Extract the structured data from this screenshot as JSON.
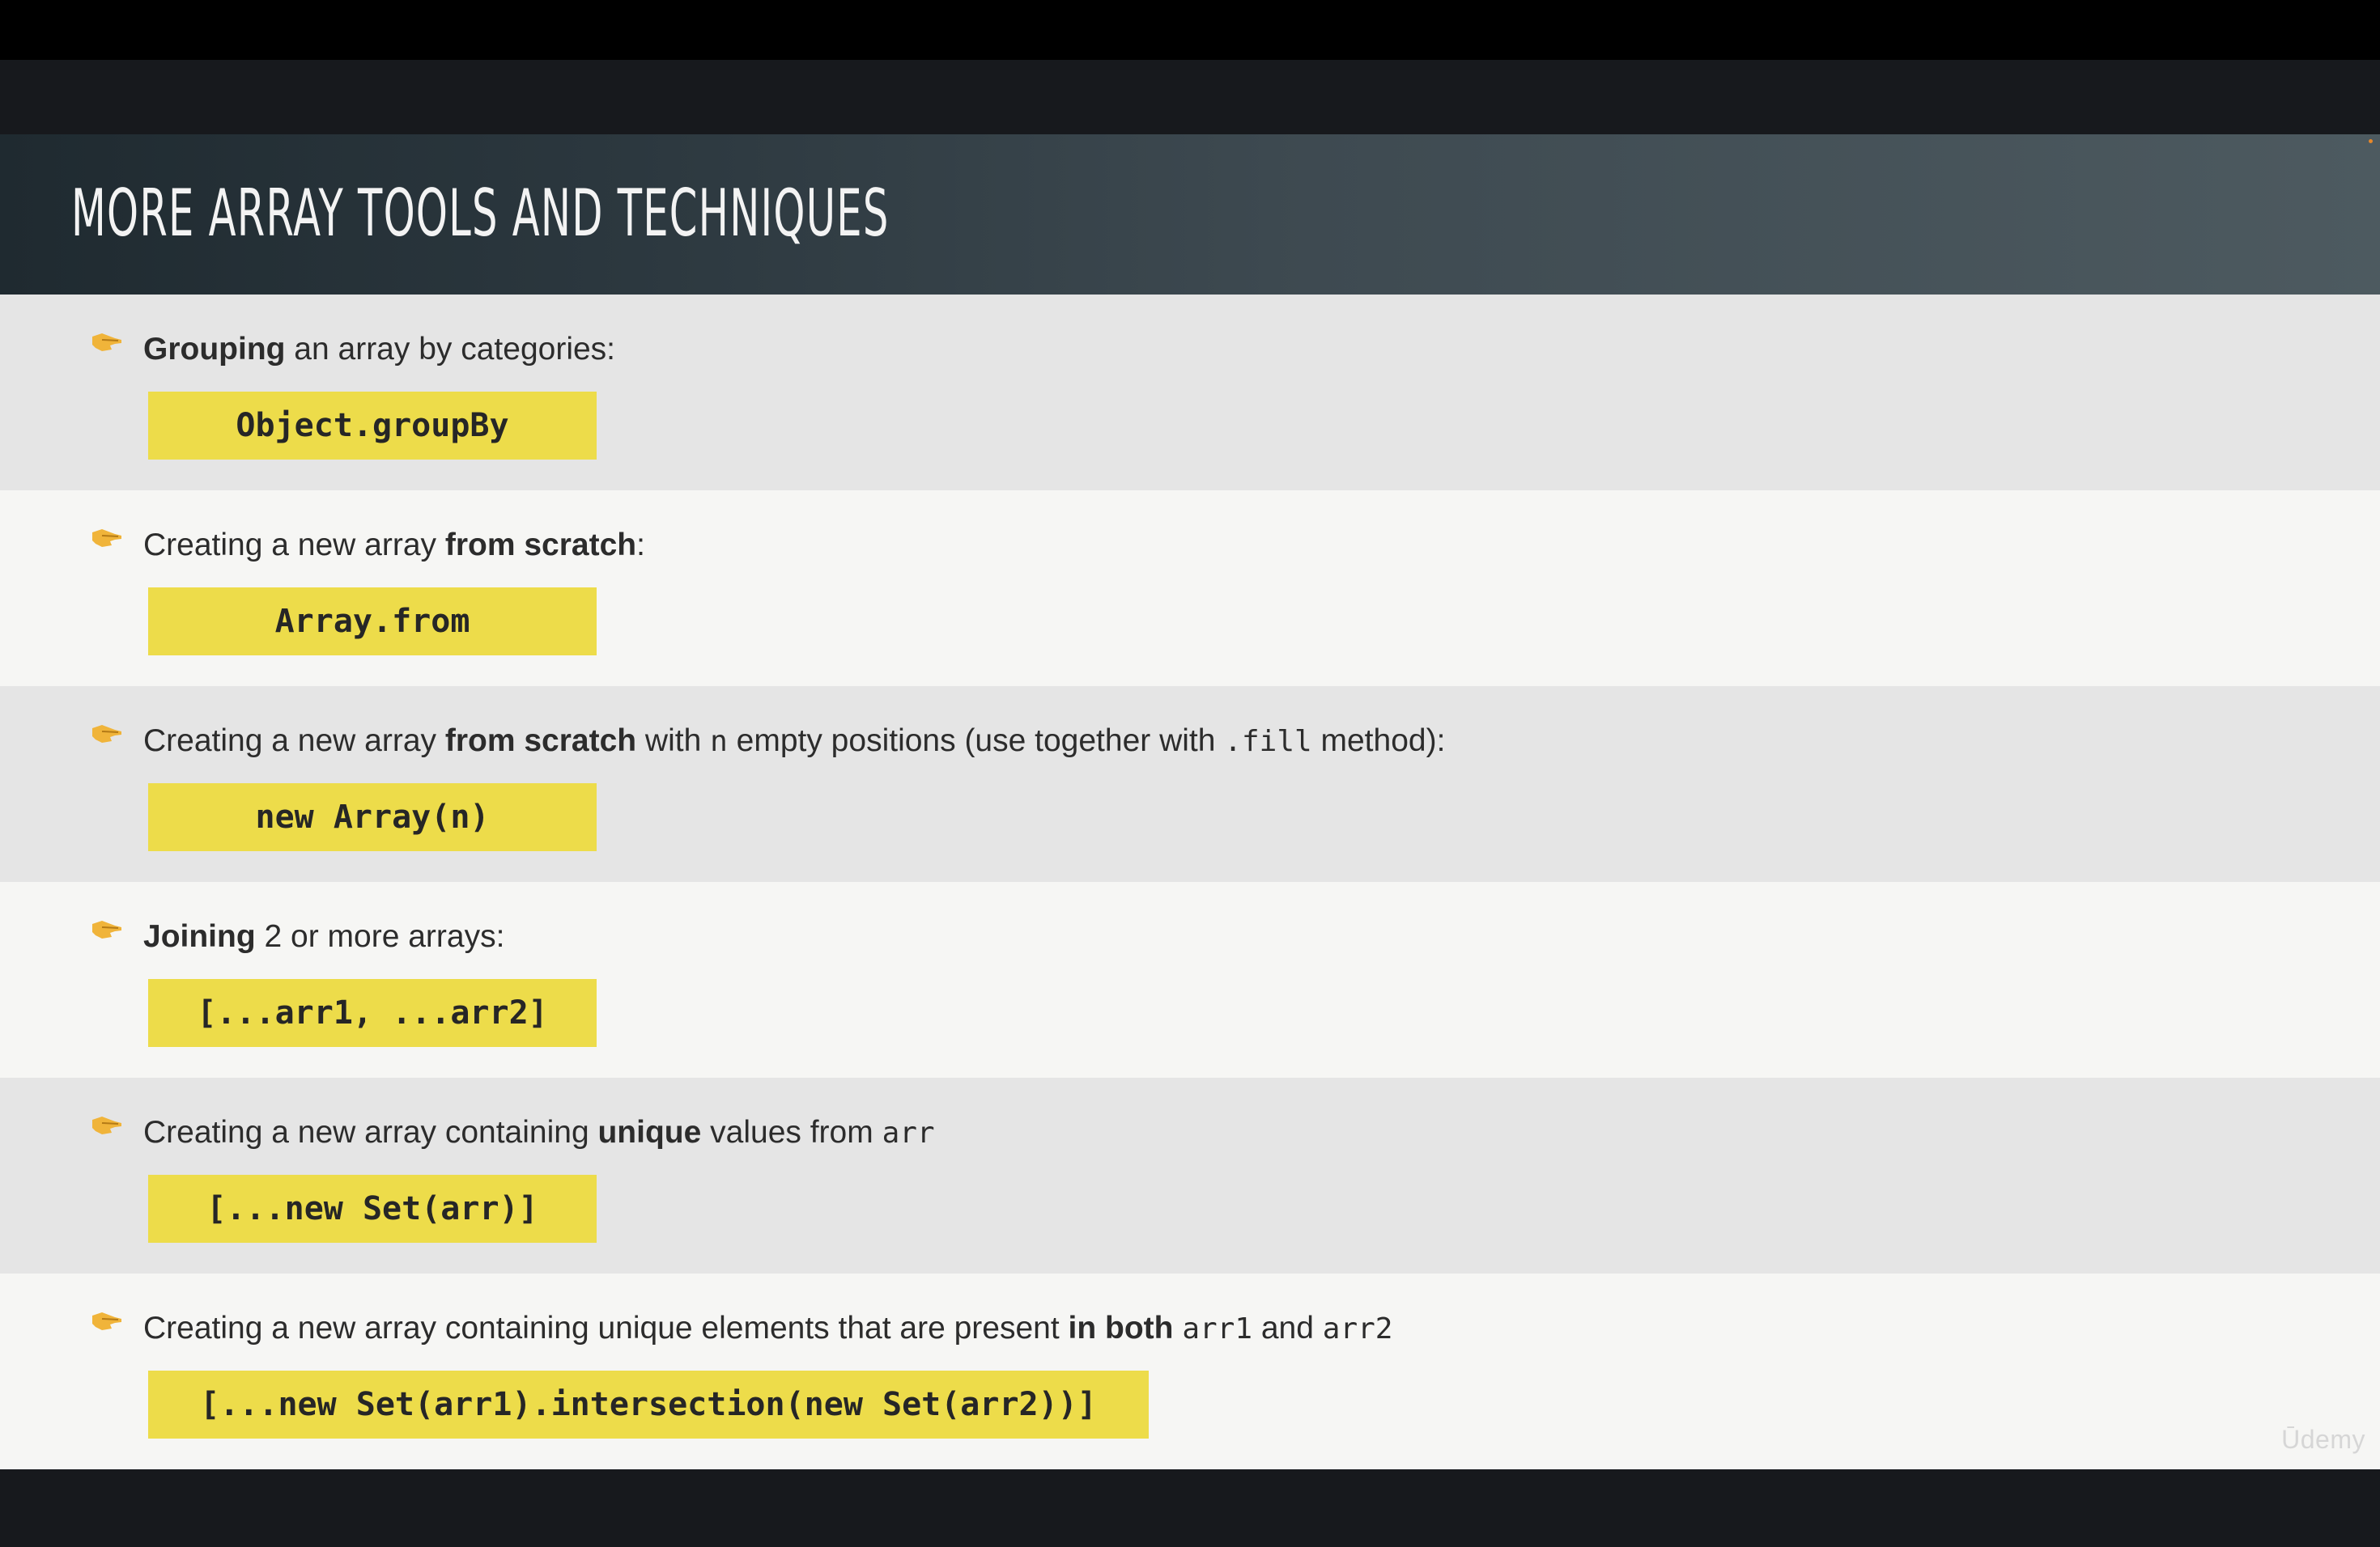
{
  "slide": {
    "title": "MORE ARRAY TOOLS AND TECHNIQUES",
    "watermark": "Ūdemy",
    "accent_color": "#eddc4a",
    "bullet_icon": "pointing-hand-icon",
    "items": [
      {
        "text_parts": [
          {
            "text": "Grouping",
            "bold": true
          },
          {
            "text": " an array by categories:"
          }
        ],
        "code": "Object.groupBy"
      },
      {
        "text_parts": [
          {
            "text": "Creating a new array "
          },
          {
            "text": "from scratch",
            "bold": true
          },
          {
            "text": ":"
          }
        ],
        "code": "Array.from"
      },
      {
        "text_parts": [
          {
            "text": "Creating a new array "
          },
          {
            "text": "from scratch",
            "bold": true
          },
          {
            "text": " with "
          },
          {
            "text": "n",
            "mono": true
          },
          {
            "text": " empty positions (use together with "
          },
          {
            "text": ".fill",
            "mono": true
          },
          {
            "text": " method):"
          }
        ],
        "code": "new Array(n)"
      },
      {
        "text_parts": [
          {
            "text": "Joining",
            "bold": true
          },
          {
            "text": " 2 or more arrays:"
          }
        ],
        "code": "[...arr1, ...arr2]"
      },
      {
        "text_parts": [
          {
            "text": "Creating a new array containing "
          },
          {
            "text": "unique",
            "bold": true
          },
          {
            "text": " values from "
          },
          {
            "text": "arr",
            "mono": true
          }
        ],
        "code": "[...new Set(arr)]"
      },
      {
        "text_parts": [
          {
            "text": "Creating a new array containing unique elements that are present "
          },
          {
            "text": "in both",
            "bold": true
          },
          {
            "text": " "
          },
          {
            "text": "arr1",
            "mono": true
          },
          {
            "text": " and "
          },
          {
            "text": "arr2",
            "mono": true
          }
        ],
        "code": "[...new Set(arr1).intersection(new Set(arr2))]"
      }
    ]
  }
}
